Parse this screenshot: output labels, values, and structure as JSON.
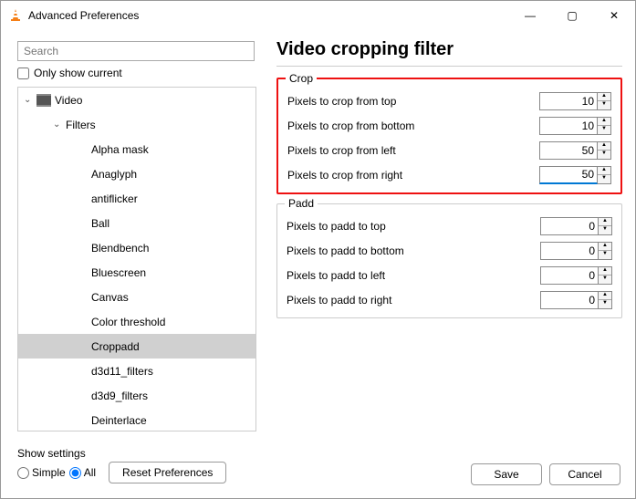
{
  "window": {
    "title": "Advanced Preferences",
    "minimize": "—",
    "maximize": "▢",
    "close": "✕"
  },
  "search": {
    "placeholder": "Search"
  },
  "only_show_current_label": "Only show current",
  "tree": {
    "video": "Video",
    "filters": "Filters",
    "items": [
      "Alpha mask",
      "Anaglyph",
      "antiflicker",
      "Ball",
      "Blendbench",
      "Bluescreen",
      "Canvas",
      "Color threshold",
      "Croppadd",
      "d3d11_filters",
      "d3d9_filters",
      "Deinterlace"
    ],
    "selected_index": 8
  },
  "page": {
    "title": "Video cropping filter",
    "crop": {
      "legend": "Crop",
      "fields": [
        {
          "label": "Pixels to crop from top",
          "value": "10"
        },
        {
          "label": "Pixels to crop from bottom",
          "value": "10"
        },
        {
          "label": "Pixels to crop from left",
          "value": "50"
        },
        {
          "label": "Pixels to crop from right",
          "value": "50"
        }
      ],
      "active_index": 3
    },
    "padd": {
      "legend": "Padd",
      "fields": [
        {
          "label": "Pixels to padd to top",
          "value": "0"
        },
        {
          "label": "Pixels to padd to bottom",
          "value": "0"
        },
        {
          "label": "Pixels to padd to left",
          "value": "0"
        },
        {
          "label": "Pixels to padd to right",
          "value": "0"
        }
      ]
    }
  },
  "footer": {
    "show_settings": "Show settings",
    "simple": "Simple",
    "all": "All",
    "reset": "Reset Preferences",
    "save": "Save",
    "cancel": "Cancel"
  },
  "icons": {
    "up": "▲",
    "down": "▼",
    "chev_down": "⌄"
  }
}
